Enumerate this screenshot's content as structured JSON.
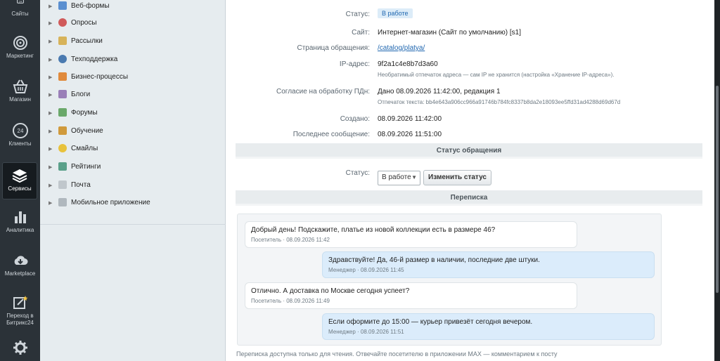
{
  "nav": [
    {
      "label": "Сайты",
      "icon": "sites-icon"
    },
    {
      "label": "Маркетинг",
      "icon": "target-icon"
    },
    {
      "label": "Магазин",
      "icon": "basket-icon"
    },
    {
      "label": "Клиенты",
      "icon": "clients-24-icon"
    },
    {
      "label": "Сервисы",
      "icon": "layers-icon"
    },
    {
      "label": "Аналитика",
      "icon": "bar-chart-icon"
    },
    {
      "label": "Marketplace",
      "icon": "cloud-download-icon"
    },
    {
      "label": "Переход в Битрикс24",
      "icon": "edit-star-icon"
    },
    {
      "label": "",
      "icon": "gear-icon"
    }
  ],
  "tree": [
    {
      "label": "Веб-формы",
      "icon": "webforms-icon",
      "color": "#5a8fd0"
    },
    {
      "label": "Опросы",
      "icon": "polls-icon",
      "color": "#d05a5a"
    },
    {
      "label": "Рассылки",
      "icon": "mail-icon",
      "color": "#d7b35a"
    },
    {
      "label": "Техподдержка",
      "icon": "headset-icon",
      "color": "#4a7ab0"
    },
    {
      "label": "Бизнес-процессы",
      "icon": "bp-icon",
      "color": "#e08a3c"
    },
    {
      "label": "Блоги",
      "icon": "blog-icon",
      "color": "#9a7fb8"
    },
    {
      "label": "Форумы",
      "icon": "forum-icon",
      "color": "#6aa86a"
    },
    {
      "label": "Обучение",
      "icon": "learning-icon",
      "color": "#d09a3c"
    },
    {
      "label": "Смайлы",
      "icon": "smile-icon",
      "color": "#e8c23c"
    },
    {
      "label": "Рейтинги",
      "icon": "rating-icon",
      "color": "#5aa08a"
    },
    {
      "label": "Почта",
      "icon": "letter-icon",
      "color": "#c0c7cc"
    },
    {
      "label": "Мобильное приложение",
      "icon": "mobile-icon",
      "color": "#b0b8be"
    }
  ],
  "details": {
    "status_label": "Статус:",
    "status_value": "В работе",
    "site_label": "Сайт:",
    "site_value": "Интернет-магазин (Сайт по умолчанию) [s1]",
    "page_label": "Страница обращения:",
    "page_value": "/catalog/platya/",
    "ip_label": "IP-адрес:",
    "ip_value": "9f2a1c4e8b7d3a60",
    "ip_note": "Необратимый отпечаток адреса — сам IP не хранится (настройка «Хранение IP-адреса»).",
    "consent_label": "Согласие на обработку ПДн:",
    "consent_value": "Дано 08.09.2026 11:42:00, редакция 1",
    "consent_note": "Отпечаток текста: bb4e643a906cc966a91746b784fc8337b8da2e18093ee5ffd31ad4288d69d67d",
    "created_label": "Создано:",
    "created_value": "08.09.2026 11:42:00",
    "last_label": "Последнее сообщение:",
    "last_value": "08.09.2026 11:51:00"
  },
  "status_section": {
    "title": "Статус обращения",
    "label": "Статус:",
    "selected": "В работе",
    "button": "Изменить статус"
  },
  "chat": {
    "title": "Переписка",
    "messages": [
      {
        "dir": "in",
        "text": "Добрый день! Подскажите, платье из новой коллекции есть в размере 46?",
        "meta": "Посетитель · 08.09.2026 11:42"
      },
      {
        "dir": "out",
        "text": "Здравствуйте! Да, 46-й размер в наличии, последние две штуки.",
        "meta": "Менеджер · 08.09.2026 11:45"
      },
      {
        "dir": "in",
        "text": "Отлично. А доставка по Москве сегодня успеет?",
        "meta": "Посетитель · 08.09.2026 11:49"
      },
      {
        "dir": "out",
        "text": "Если оформите до 15:00 — курьер привезёт сегодня вечером.",
        "meta": "Менеджер · 08.09.2026 11:51"
      }
    ],
    "footnote": "Переписка доступна только для чтения. Отвечайте посетителю в приложении MAX — комментарием к посту"
  }
}
